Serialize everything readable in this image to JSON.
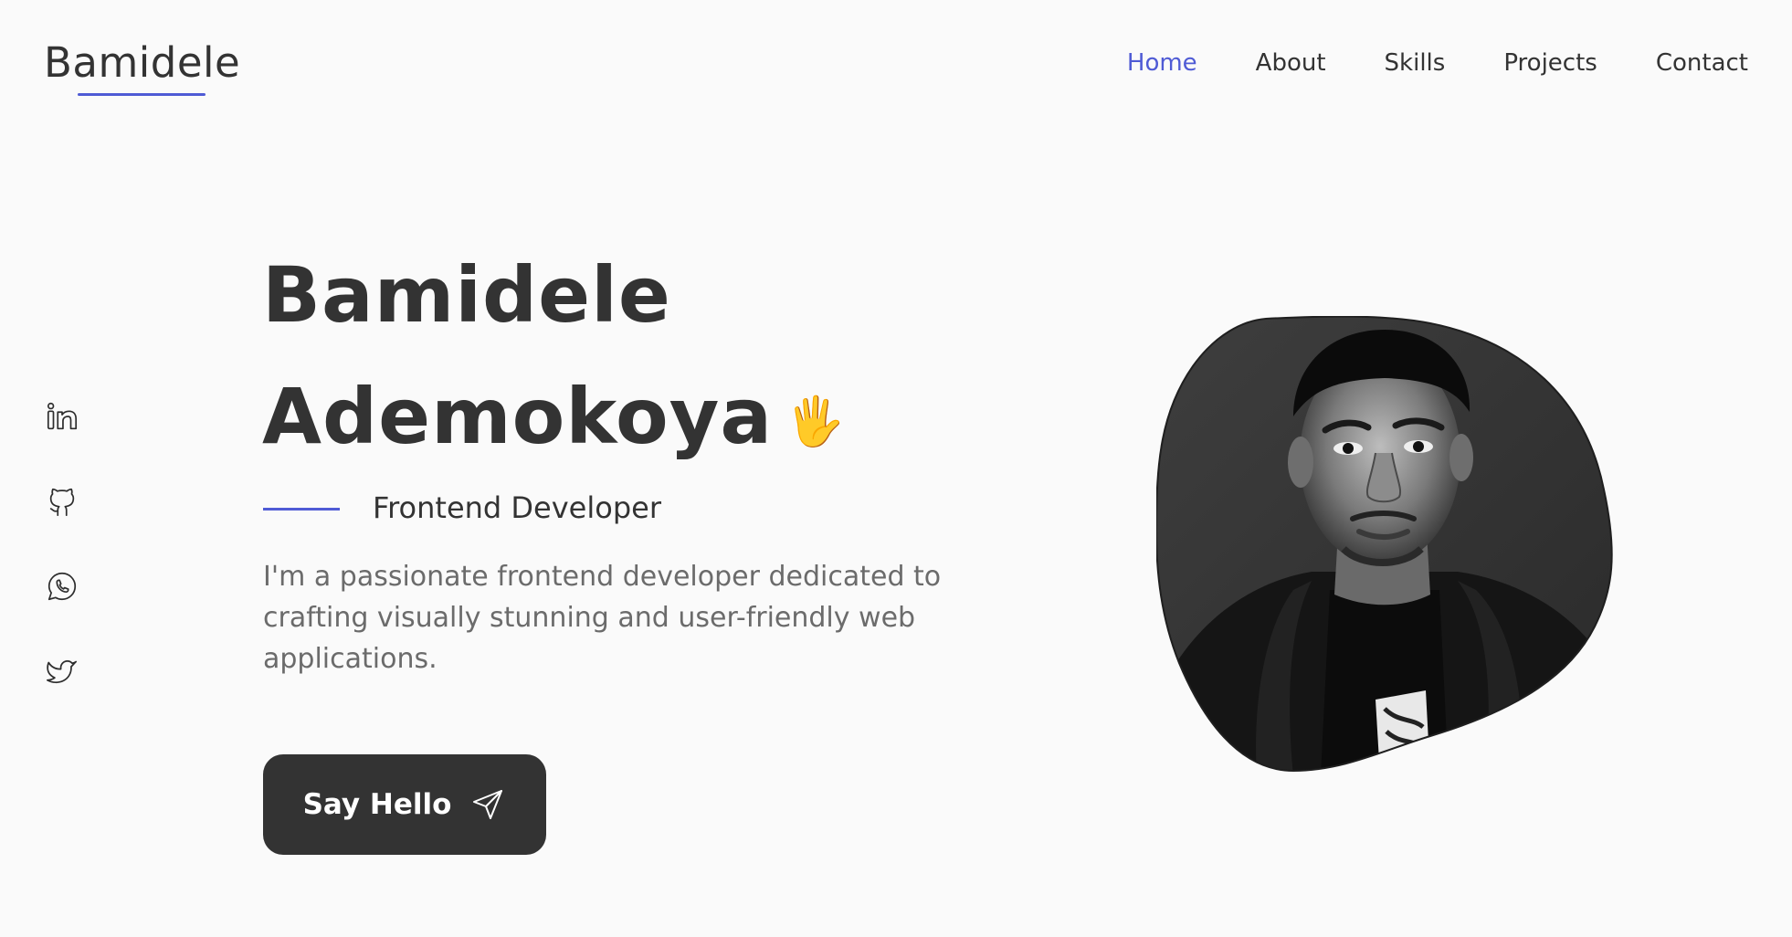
{
  "header": {
    "logo": "Bamidele",
    "nav": [
      {
        "label": "Home",
        "active": true
      },
      {
        "label": "About",
        "active": false
      },
      {
        "label": "Skills",
        "active": false
      },
      {
        "label": "Projects",
        "active": false
      },
      {
        "label": "Contact",
        "active": false
      }
    ]
  },
  "social": [
    {
      "icon": "linkedin-icon"
    },
    {
      "icon": "github-icon"
    },
    {
      "icon": "whatsapp-icon"
    },
    {
      "icon": "twitter-icon"
    }
  ],
  "hero": {
    "first_name": "Bamidele",
    "last_name": "Ademokoya",
    "wave_emoji": "🖐",
    "role": "Frontend Developer",
    "description": "I'm a passionate frontend developer dedicated to crafting visually stunning and user-friendly web applications.",
    "cta_label": "Say Hello"
  },
  "colors": {
    "accent": "#4f5bd5",
    "text": "#333333",
    "muted": "#6b6b6b",
    "background": "#fafafa"
  }
}
